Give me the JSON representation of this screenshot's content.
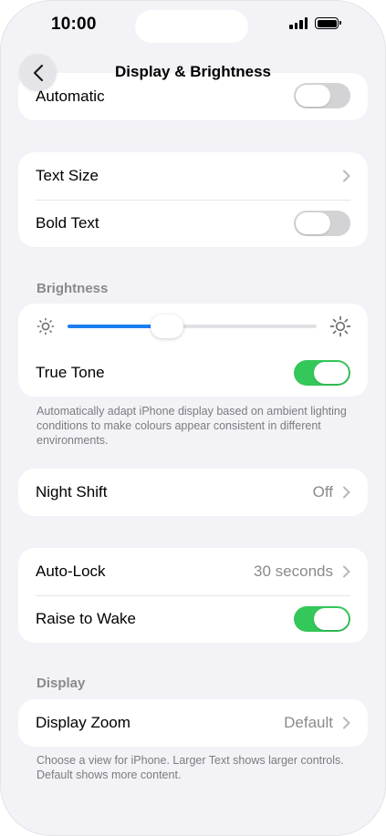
{
  "status": {
    "time": "10:00"
  },
  "nav": {
    "title": "Display & Brightness",
    "back_icon": "chevron-left-icon"
  },
  "appearance": {
    "automatic_label": "Automatic",
    "automatic_on": false
  },
  "text_group": {
    "text_size_label": "Text Size",
    "bold_text_label": "Bold Text",
    "bold_text_on": false
  },
  "brightness": {
    "header": "Brightness",
    "level_percent": 40,
    "low_icon": "sun-small-icon",
    "high_icon": "sun-large-icon",
    "true_tone_label": "True Tone",
    "true_tone_on": true,
    "footer": "Automatically adapt iPhone display based on ambient lighting conditions to make colours appear consistent in different environments."
  },
  "night_shift": {
    "label": "Night Shift",
    "value": "Off"
  },
  "lock_group": {
    "auto_lock_label": "Auto-Lock",
    "auto_lock_value": "30 seconds",
    "raise_to_wake_label": "Raise to Wake",
    "raise_to_wake_on": true
  },
  "display": {
    "header": "Display",
    "zoom_label": "Display Zoom",
    "zoom_value": "Default",
    "footer": "Choose a view for iPhone. Larger Text shows larger controls. Default shows more content."
  },
  "colors": {
    "accent": "#1c7ef0",
    "toggle_on": "#34c759",
    "toggle_off": "#d3d3d6",
    "background": "#f2f2f7"
  }
}
